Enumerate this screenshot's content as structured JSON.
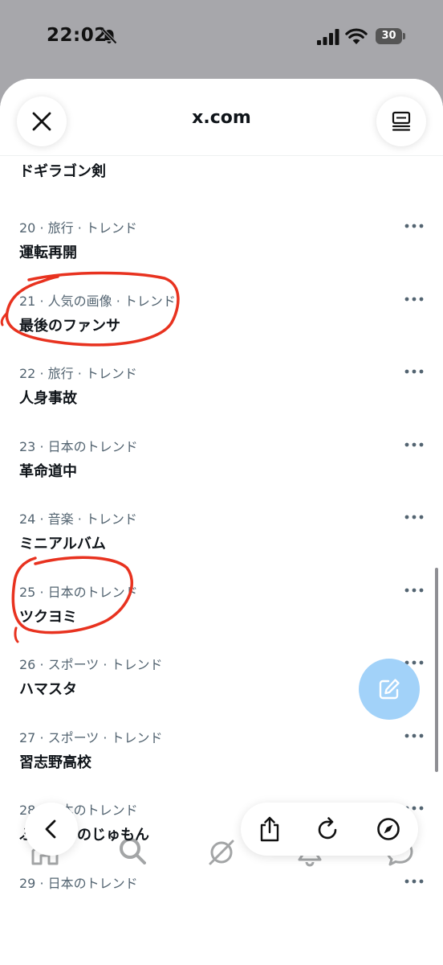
{
  "status_bar": {
    "time": "22:02",
    "battery": "30"
  },
  "sheet": {
    "title": "x.com"
  },
  "trends": [
    {
      "meta": "20 · 旅行 · トレンド",
      "name": "運転再開"
    },
    {
      "meta": "21 · 人気の画像 · トレンド",
      "name": "最後のファンサ"
    },
    {
      "meta": "22 · 旅行 · トレンド",
      "name": "人身事故"
    },
    {
      "meta": "23 · 日本のトレンド",
      "name": "革命道中"
    },
    {
      "meta": "24 · 音楽 · トレンド",
      "name": "ミニアルバム"
    },
    {
      "meta": "25 · 日本のトレンド",
      "name": "ツクヨミ"
    },
    {
      "meta": "26 · スポーツ · トレンド",
      "name": "ハマスタ"
    },
    {
      "meta": "27 · スポーツ · トレンド",
      "name": "習志野高校"
    },
    {
      "meta": "28 · 日本のトレンド",
      "name": "ふっかつのじゅもん"
    },
    {
      "meta": "29 · 日本のトレンド",
      "name": ""
    }
  ],
  "partial_trend": {
    "name": "ドギラゴン剣"
  },
  "colors": {
    "annotation": "#e8321f",
    "fab": "#a2d2f9",
    "meta_text": "#536471"
  },
  "icons": {
    "close": "close-icon",
    "reader": "reader-icon",
    "more": "more-icon",
    "compose": "compose-icon",
    "nav": [
      "home-icon",
      "search-icon",
      "grok-icon",
      "bell-icon",
      "messages-icon"
    ],
    "toolbar": [
      "back-icon",
      "share-icon",
      "reload-icon",
      "compass-icon"
    ]
  }
}
